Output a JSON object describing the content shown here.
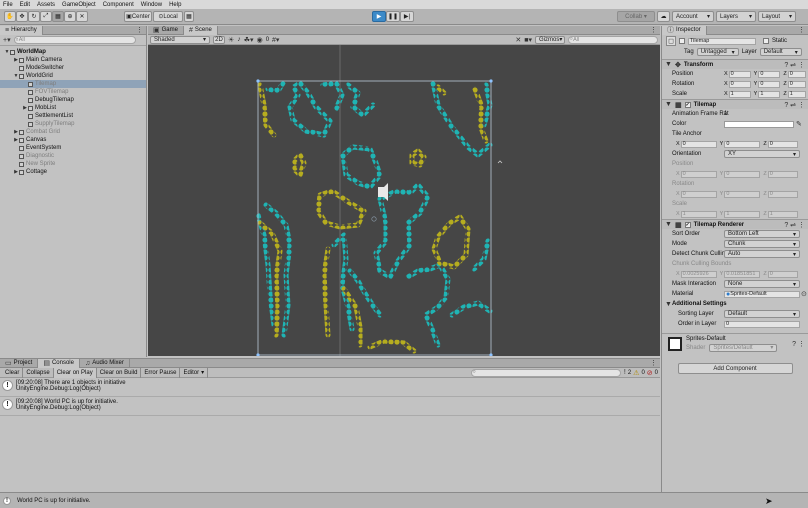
{
  "menu": [
    "File",
    "Edit",
    "Assets",
    "GameObject",
    "Component",
    "Window",
    "Help"
  ],
  "toolbar": {
    "pivot": "Center",
    "space": "Local",
    "collab": "Collab ▾",
    "account": "Account",
    "layers": "Layers",
    "layout": "Layout"
  },
  "hierarchy": {
    "tab": "Hierarchy",
    "search_placeholder": "All",
    "items": [
      {
        "label": "WorldMap",
        "depth": 0,
        "arrow": "▼",
        "bold": true,
        "dim": false,
        "sel": false
      },
      {
        "label": "Main Camera",
        "depth": 1,
        "arrow": "▶",
        "bold": false,
        "dim": false,
        "sel": false
      },
      {
        "label": "ModeSwitcher",
        "depth": 1,
        "arrow": "",
        "bold": false,
        "dim": false,
        "sel": false
      },
      {
        "label": "WorldGrid",
        "depth": 1,
        "arrow": "▼",
        "bold": false,
        "dim": false,
        "sel": false
      },
      {
        "label": "Tilemap",
        "depth": 2,
        "arrow": "",
        "bold": false,
        "dim": true,
        "sel": true
      },
      {
        "label": "FOVTilemap",
        "depth": 2,
        "arrow": "",
        "bold": false,
        "dim": true,
        "sel": false
      },
      {
        "label": "DebugTilemap",
        "depth": 2,
        "arrow": "",
        "bold": false,
        "dim": false,
        "sel": false
      },
      {
        "label": "MobList",
        "depth": 2,
        "arrow": "▶",
        "bold": false,
        "dim": false,
        "sel": false
      },
      {
        "label": "SettlementList",
        "depth": 2,
        "arrow": "",
        "bold": false,
        "dim": false,
        "sel": false
      },
      {
        "label": "SupplyTilemap",
        "depth": 2,
        "arrow": "",
        "bold": false,
        "dim": true,
        "sel": false
      },
      {
        "label": "Combat Grid",
        "depth": 1,
        "arrow": "▶",
        "bold": false,
        "dim": true,
        "sel": false
      },
      {
        "label": "Canvas",
        "depth": 1,
        "arrow": "▶",
        "bold": false,
        "dim": false,
        "sel": false
      },
      {
        "label": "EventSystem",
        "depth": 1,
        "arrow": "",
        "bold": false,
        "dim": false,
        "sel": false
      },
      {
        "label": "Diagnostic",
        "depth": 1,
        "arrow": "",
        "bold": false,
        "dim": true,
        "sel": false
      },
      {
        "label": "New Sprite",
        "depth": 1,
        "arrow": "",
        "bold": false,
        "dim": true,
        "sel": false
      },
      {
        "label": "Cottage",
        "depth": 1,
        "arrow": "▶",
        "bold": false,
        "dim": false,
        "sel": false
      }
    ]
  },
  "scene": {
    "tabs": [
      "Game",
      "Scene"
    ],
    "shading": "Shaded",
    "mode2d": "2D",
    "fx_count": "0",
    "gizmos": "Gizmos",
    "search_placeholder": "All"
  },
  "console": {
    "tabs": [
      "Project",
      "Console",
      "Audio Mixer"
    ],
    "buttons": [
      "Clear",
      "Collapse",
      "Clear on Play",
      "Clear on Build",
      "Error Pause",
      "Editor"
    ],
    "warn_count": "2",
    "info_count": "0",
    "err_count": "0",
    "entries": [
      {
        "line1": "[09:20:08] There are 1 objects in initiative",
        "line2": "UnityEngine.Debug:Log(Object)"
      },
      {
        "line1": "[09:20:08] World PC is up for initiative.",
        "line2": "UnityEngine.Debug:Log(Object)"
      }
    ]
  },
  "status": "World PC is up for initiative.",
  "inspector": {
    "tab": "Inspector",
    "object_name": "Tilemap",
    "static": "Static",
    "tag_label": "Tag",
    "tag": "Untagged",
    "layer_label": "Layer",
    "layer": "Default",
    "transform": {
      "title": "Transform",
      "rows": [
        {
          "label": "Position",
          "x": "0",
          "y": "0",
          "z": "0"
        },
        {
          "label": "Rotation",
          "x": "0",
          "y": "0",
          "z": "0"
        },
        {
          "label": "Scale",
          "x": "1",
          "y": "1",
          "z": "1"
        }
      ]
    },
    "tilemap": {
      "title": "Tilemap",
      "frame_rate_label": "Animation Frame Rat",
      "frame_rate": "1",
      "color_label": "Color",
      "anchor_label": "Tile Anchor",
      "anchor": {
        "x": "0",
        "y": "0",
        "z": "0"
      },
      "orientation_label": "Orientation",
      "orientation": "XY",
      "position_label": "Position",
      "position": {
        "x": "0",
        "y": "0",
        "z": "0"
      },
      "rotation_label": "Rotation",
      "rotation": {
        "x": "0",
        "y": "0",
        "z": "0"
      },
      "scale_label": "Scale",
      "scale": {
        "x": "1",
        "y": "1",
        "z": "1"
      }
    },
    "renderer": {
      "title": "Tilemap Renderer",
      "rows": [
        {
          "label": "Sort Order",
          "value": "Bottom Left"
        },
        {
          "label": "Mode",
          "value": "Chunk"
        },
        {
          "label": "Detect Chunk Culling",
          "value": "Auto"
        }
      ],
      "bounds_label": "Chunk Culling Bounds",
      "bounds": {
        "x": "0.0025926",
        "y": "0.01851851",
        "z": "0"
      },
      "mask_label": "Mask Interaction",
      "mask": "None",
      "material_label": "Material",
      "material": "Sprites-Default",
      "additional_title": "Additional Settings",
      "sorting_label": "Sorting Layer",
      "sorting": "Default",
      "order_label": "Order in Layer",
      "order": "0"
    },
    "material_block": {
      "name": "Sprites-Default",
      "shader_label": "Shader",
      "shader": "Sprites/Default"
    },
    "add_component": "Add Component"
  },
  "colors": {
    "teal": "#1fb4b4",
    "olive": "#b6ad1f",
    "scene_bg": "#464646"
  }
}
